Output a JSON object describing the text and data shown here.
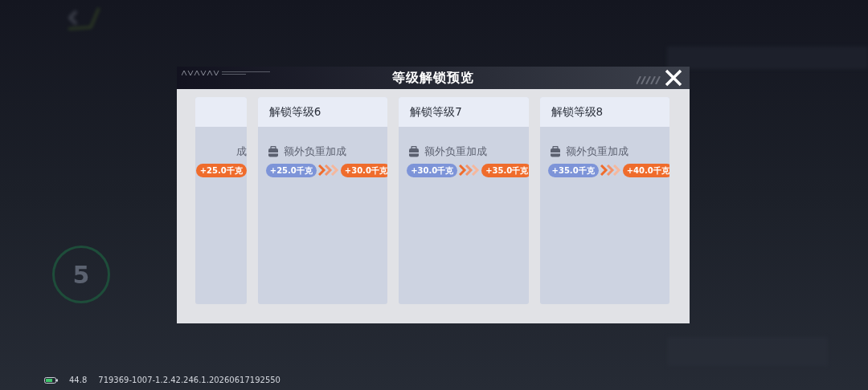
{
  "background": {
    "level": "5"
  },
  "dialog": {
    "title": "等级解锁预览",
    "cards": [
      {
        "kind": "partial",
        "label": "成",
        "to": "+25.0千克"
      },
      {
        "kind": "full",
        "title": "解锁等级6",
        "label": "额外负重加成",
        "from": "+25.0千克",
        "to": "+30.0千克"
      },
      {
        "kind": "full",
        "title": "解锁等级7",
        "label": "额外负重加成",
        "from": "+30.0千克",
        "to": "+35.0千克"
      },
      {
        "kind": "full",
        "title": "解锁等级8",
        "label": "额外负重加成",
        "from": "+35.0千克",
        "to": "+40.0千克"
      }
    ]
  },
  "status_bar": {
    "value": "44.8",
    "build": "719369-1007-1.2.42.246.1.20260617192550"
  }
}
